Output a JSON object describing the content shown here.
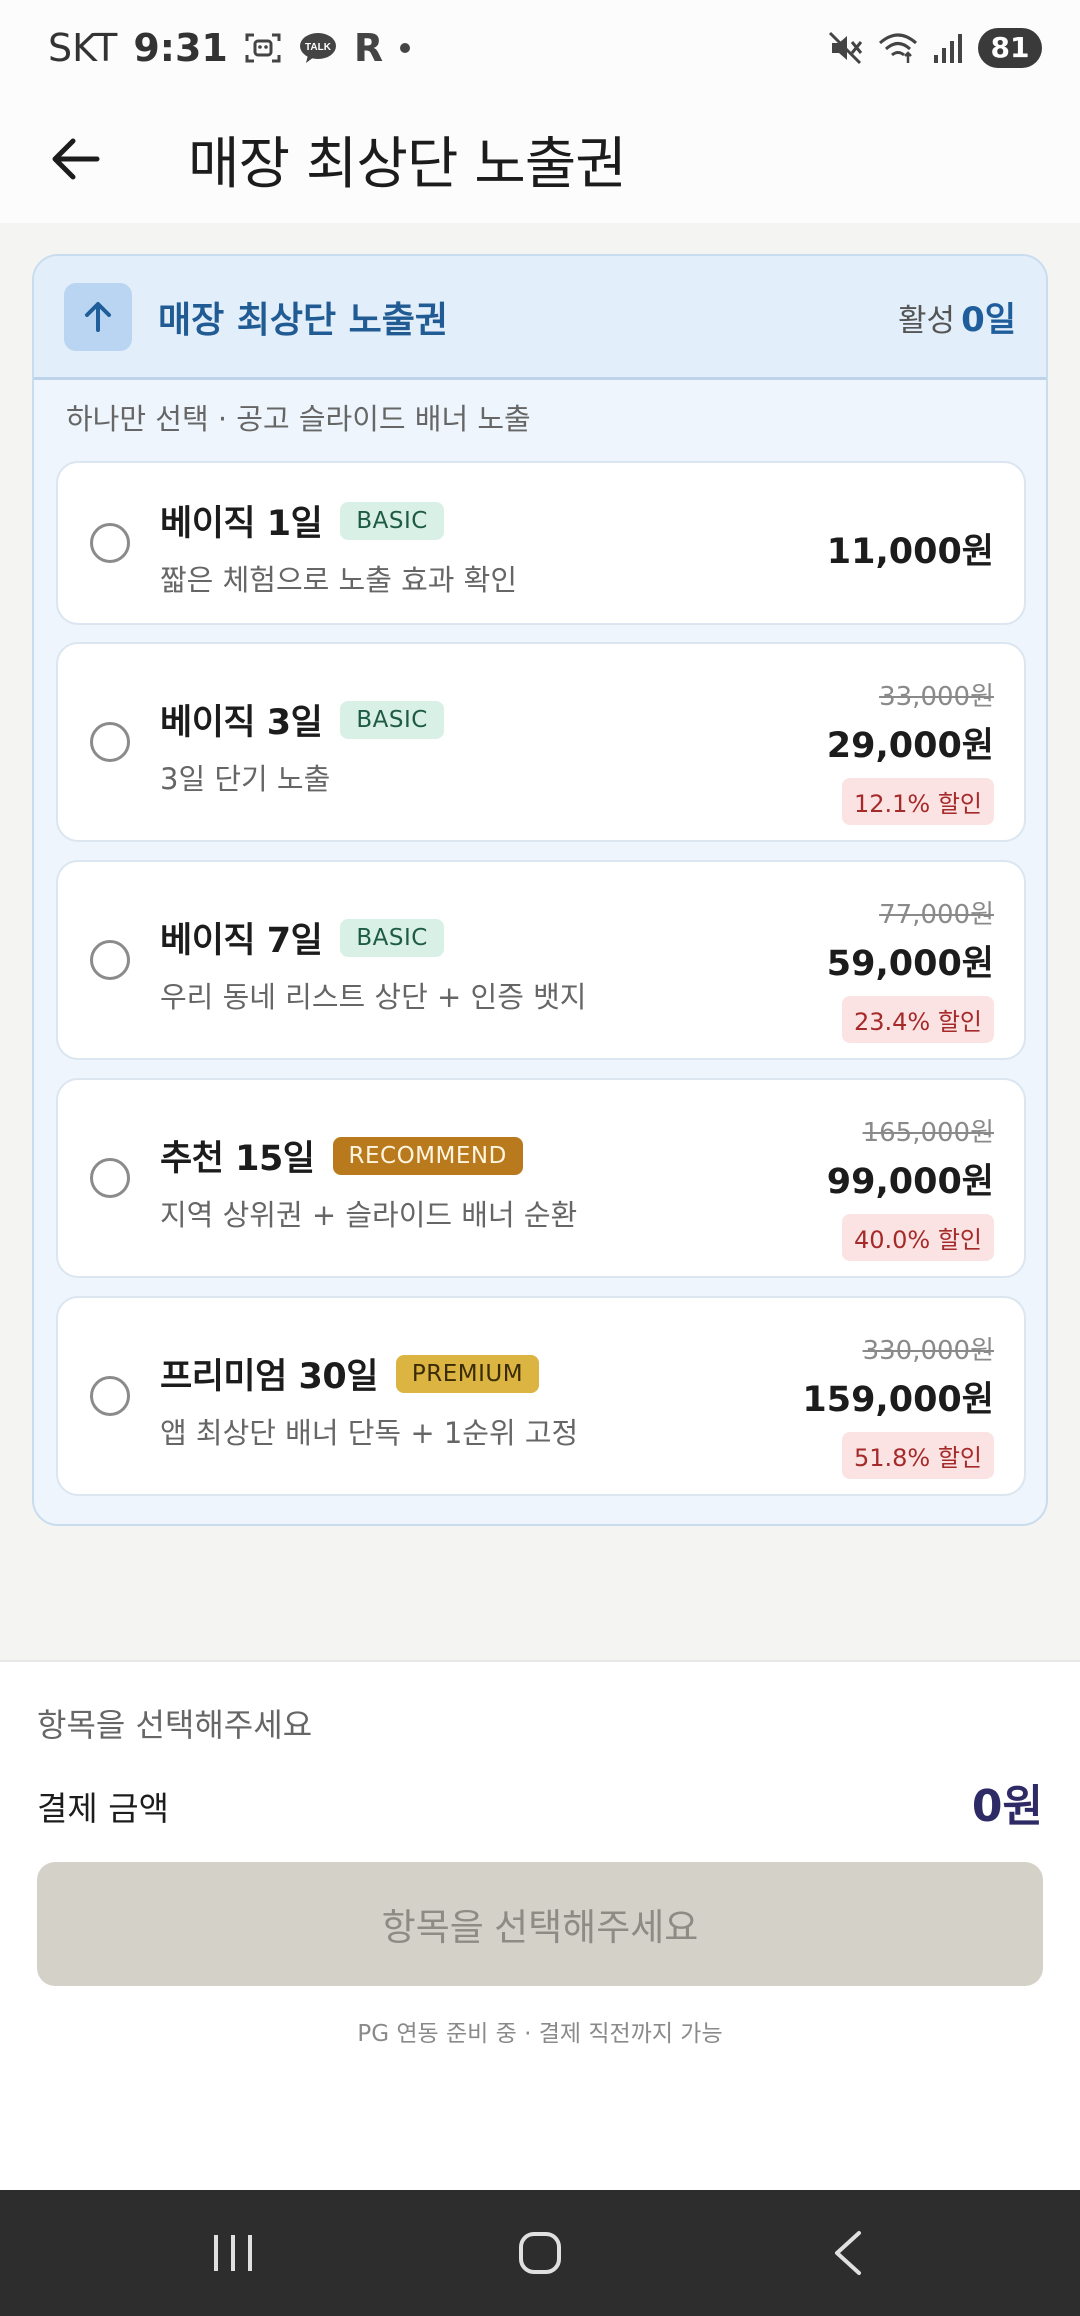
{
  "status_bar": {
    "carrier": "SKT",
    "time": "9:31",
    "icons_left": [
      "bixby-vision-icon",
      "kakaotalk-icon",
      "r-app-icon",
      "dot-icon"
    ],
    "kakao_label": "TALK",
    "r_label": "R",
    "icons_right": [
      "mute-icon",
      "wifi-icon",
      "signal-icon"
    ],
    "battery": "81"
  },
  "app_bar": {
    "title": "매장 최상단 노출권",
    "back_icon": "arrow-left-icon"
  },
  "panel": {
    "title": "매장 최상단 노출권",
    "active_label": "활성",
    "active_days": "0일",
    "hint": "하나만 선택 · 공고 슬라이드 배너 노출",
    "options": [
      {
        "name": "베이직 1일",
        "badge": "BASIC",
        "desc": "짧은 체험으로 노출 효과 확인",
        "original_price": "",
        "price": "11,000원",
        "discount": ""
      },
      {
        "name": "베이직 3일",
        "badge": "BASIC",
        "desc": "3일 단기 노출",
        "original_price": "33,000원",
        "price": "29,000원",
        "discount": "12.1% 할인"
      },
      {
        "name": "베이직 7일",
        "badge": "BASIC",
        "desc": "우리 동네 리스트 상단 + 인증 뱃지",
        "original_price": "77,000원",
        "price": "59,000원",
        "discount": "23.4% 할인"
      },
      {
        "name": "추천 15일",
        "badge": "RECOMMEND",
        "desc": "지역 상위권 + 슬라이드 배너 순환",
        "original_price": "165,000원",
        "price": "99,000원",
        "discount": "40.0% 할인"
      },
      {
        "name": "프리미엄 30일",
        "badge": "PREMIUM",
        "desc": "앱 최상단 배너 단독 + 1순위 고정",
        "original_price": "330,000원",
        "price": "159,000원",
        "discount": "51.8% 할인"
      }
    ]
  },
  "payment": {
    "select_prompt": "항목을 선택해주세요",
    "amount_label": "결제 금액",
    "amount": "0원",
    "button_label": "항목을 선택해주세요",
    "note": "PG 연동 준비 중 · 결제 직전까지 가능"
  },
  "colors": {
    "accent_blue": "#215b93",
    "amount_color": "#2e2a66",
    "disabled_button": "#d4d1c9",
    "discount_red": "#a52a2a"
  }
}
